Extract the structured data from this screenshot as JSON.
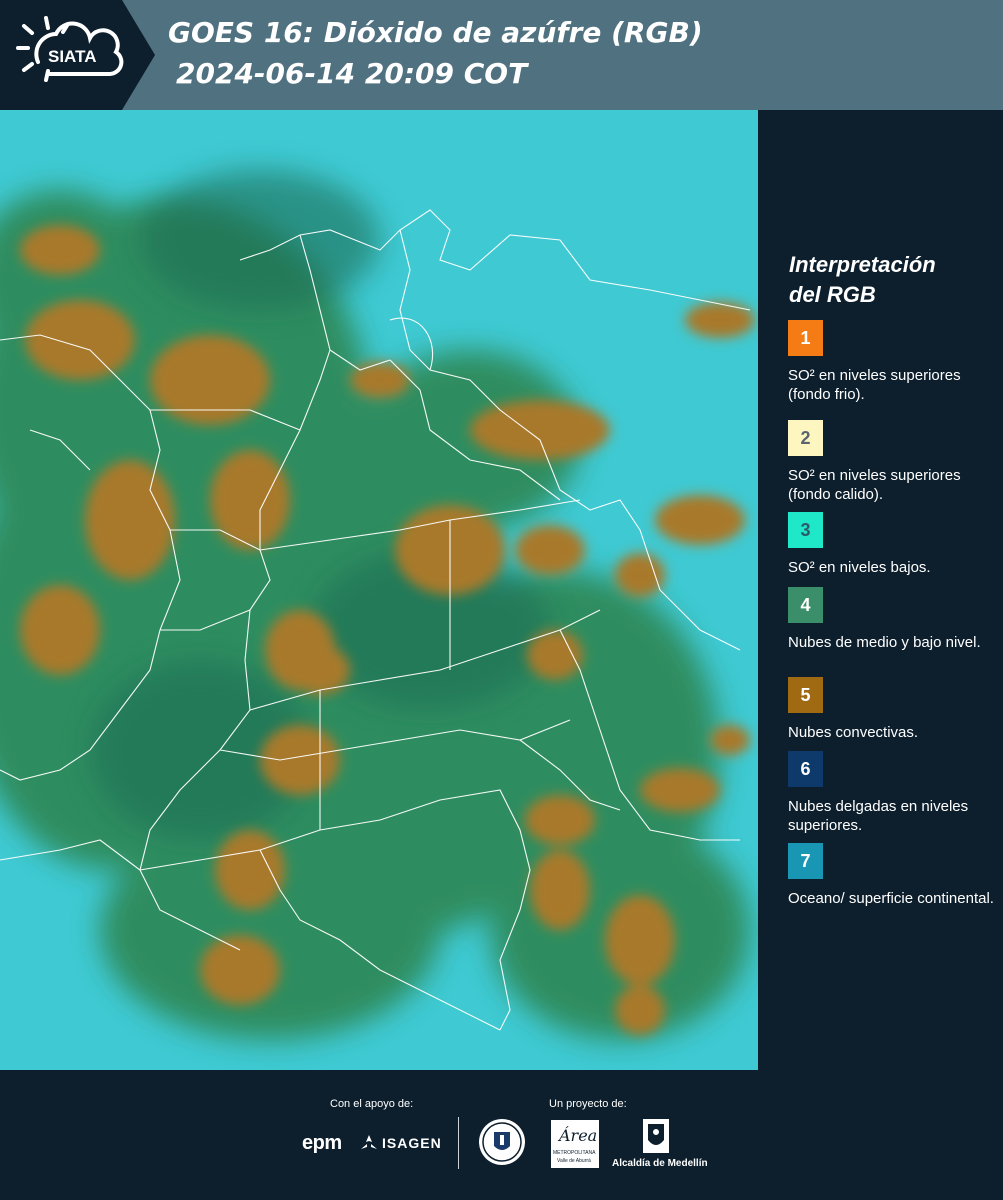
{
  "header": {
    "logo_text": "SIATA",
    "title_line1": "GOES 16: Dióxido de azúfre (RGB)",
    "title_line2": "2024-06-14 20:09 COT"
  },
  "legend": {
    "title_line1": "Interpretación",
    "title_line2": "del RGB",
    "items": [
      {
        "number": "1",
        "color": "#f57c14",
        "number_color": "#ffffff",
        "text": "SO² en niveles superiores (fondo frio)."
      },
      {
        "number": "2",
        "color": "#fdf6c0",
        "number_color": "#5a6470",
        "text": "SO² en niveles superiores (fondo calido)."
      },
      {
        "number": "3",
        "color": "#1ee8c8",
        "number_color": "#2d5a6a",
        "text": "SO² en niveles bajos."
      },
      {
        "number": "4",
        "color": "#3a8f6a",
        "number_color": "#ffffff",
        "text": "Nubes de medio y bajo nivel."
      },
      {
        "number": "5",
        "color": "#a06a12",
        "number_color": "#ffffff",
        "text": "Nubes convectivas."
      },
      {
        "number": "6",
        "color": "#0d3a6a",
        "number_color": "#ffffff",
        "text": "Nubes delgadas en niveles superiores."
      },
      {
        "number": "7",
        "color": "#1896b4",
        "number_color": "#ffffff",
        "text": "Oceano/ superficie continental."
      }
    ]
  },
  "map": {
    "colors": {
      "ocean_surface": "#3fc9d2",
      "mid_low_clouds": "#2f8a5a",
      "convective": "#a8792c",
      "borders": "#ffffff"
    }
  },
  "footer": {
    "support_label": "Con el apoyo de:",
    "sponsor1": "epm",
    "sponsor2": "ISAGEN",
    "project_label": "Un proyecto de:",
    "seal_icon": "medellin-seal-icon",
    "amva_name": "Área",
    "amva_sub1": "METROPOLITANA",
    "amva_sub2": "Valle de Aburrá",
    "alcaldia": "Alcaldía de Medellín"
  }
}
